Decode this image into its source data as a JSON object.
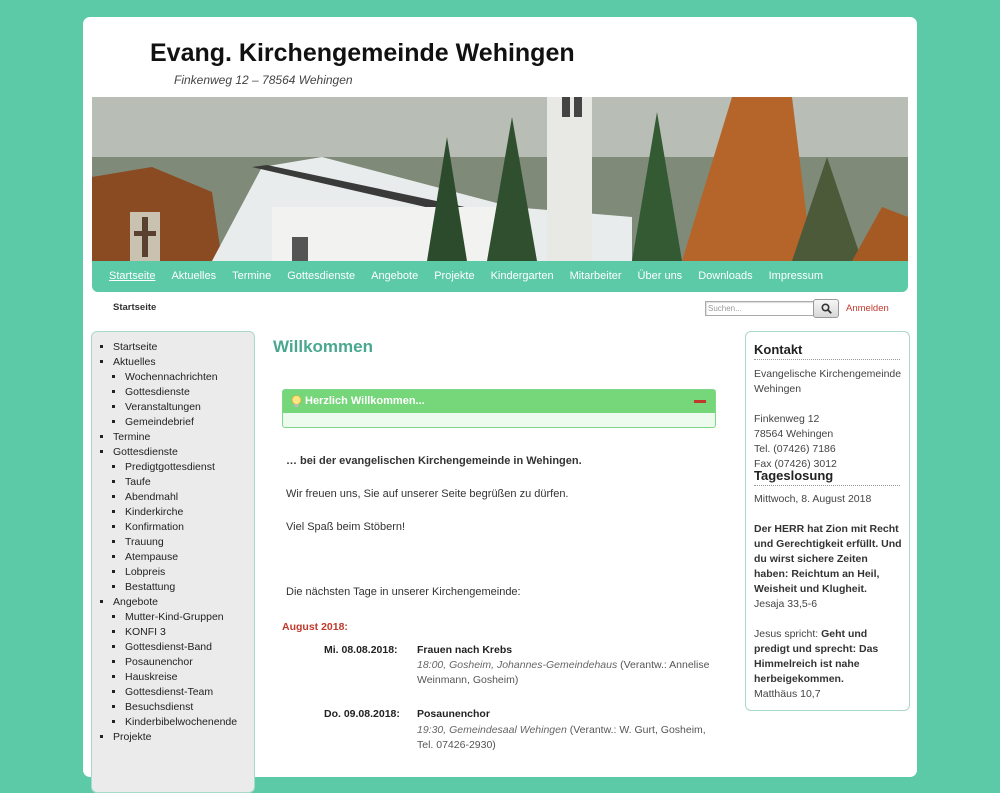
{
  "site": {
    "title": "Evang. Kirchengemeinde Wehingen",
    "description": "Finkenweg 12 – 78564 Wehingen"
  },
  "nav": {
    "items": [
      "Startseite",
      "Aktuelles",
      "Termine",
      "Gottesdienste",
      "Angebote",
      "Projekte",
      "Kindergarten",
      "Mitarbeiter",
      "Über uns",
      "Downloads",
      "Impressum"
    ]
  },
  "breadcrumb": "Startseite",
  "search": {
    "placeholder": "Suchen..."
  },
  "login": "Anmelden",
  "left_menu": {
    "startseite": "Startseite",
    "aktuelles": "Aktuelles",
    "aktuelles_children": [
      "Wochennachrichten",
      "Gottesdienste",
      "Veranstaltungen",
      "Gemeindebrief"
    ],
    "termine": "Termine",
    "gottesdienste": "Gottesdienste",
    "gottesdienste_children": [
      "Predigtgottesdienst",
      "Taufe",
      "Abendmahl",
      "Kinderkirche",
      "Konfirmation",
      "Trauung",
      "Atempause",
      "Lobpreis",
      "Bestattung"
    ],
    "angebote": "Angebote",
    "angebote_children": [
      "Mutter-Kind-Gruppen",
      "KONFI 3",
      "Gottesdienst-Band",
      "Posaunenchor",
      "Hauskreise",
      "Gottesdienst-Team",
      "Besuchsdienst",
      "Kinderbibelwochenende"
    ],
    "projekte": "Projekte"
  },
  "content": {
    "title": "Willkommen",
    "box_title": "Herzlich Willkommen...",
    "intro": "… bei der evangelischen Kirchengemeinde in Wehingen.",
    "greeting": "Wir freuen uns, Sie auf unserer Seite begrüßen zu dürfen.",
    "fun": "Viel Spaß beim Stöbern!",
    "next_days": "Die nächsten Tage in unserer Kirchengemeinde:",
    "month": "August 2018:",
    "events": [
      {
        "date": "Mi. 08.08.2018:",
        "title": "Frauen nach Krebs",
        "detail_italic": "18:00, Gosheim, Johannes-Gemeindehaus",
        "detail_rest": " (Verantw.: Annelise Weinmann, Gosheim)"
      },
      {
        "date": "Do. 09.08.2018:",
        "title": "Posaunenchor",
        "detail_italic": "19:30, Gemeindesaal Wehingen",
        "detail_rest": " (Verantw.: W. Gurt, Gosheim, Tel. 07426-2930)"
      }
    ]
  },
  "contact": {
    "title": "Kontakt",
    "lines": [
      "Evangelische Kirchengemeinde Wehingen",
      "Finkenweg 12",
      "78564 Wehingen",
      "Tel. (07426) 7186",
      "Fax (07426) 3012"
    ]
  },
  "losung": {
    "title": "Tageslosung",
    "date": "Mittwoch, 8. August 2018",
    "verse": "Der HERR hat Zion mit Recht und Gerechtigkeit erfüllt. Und du wirst sichere Zeiten haben: Reichtum an Heil, Weisheit und Klugheit.",
    "verse_ref": "Jesaja 33,5-6",
    "jesus_prefix": "Jesus spricht: ",
    "jesus_quote": "Geht und predigt und sprecht: Das Himmelreich ist nahe herbeigekommen.",
    "jesus_ref": "Matthäus 10,7"
  },
  "colors": {
    "accent": "#5cc9a7",
    "link_red": "#c0392b",
    "box_green": "#76d67a"
  }
}
